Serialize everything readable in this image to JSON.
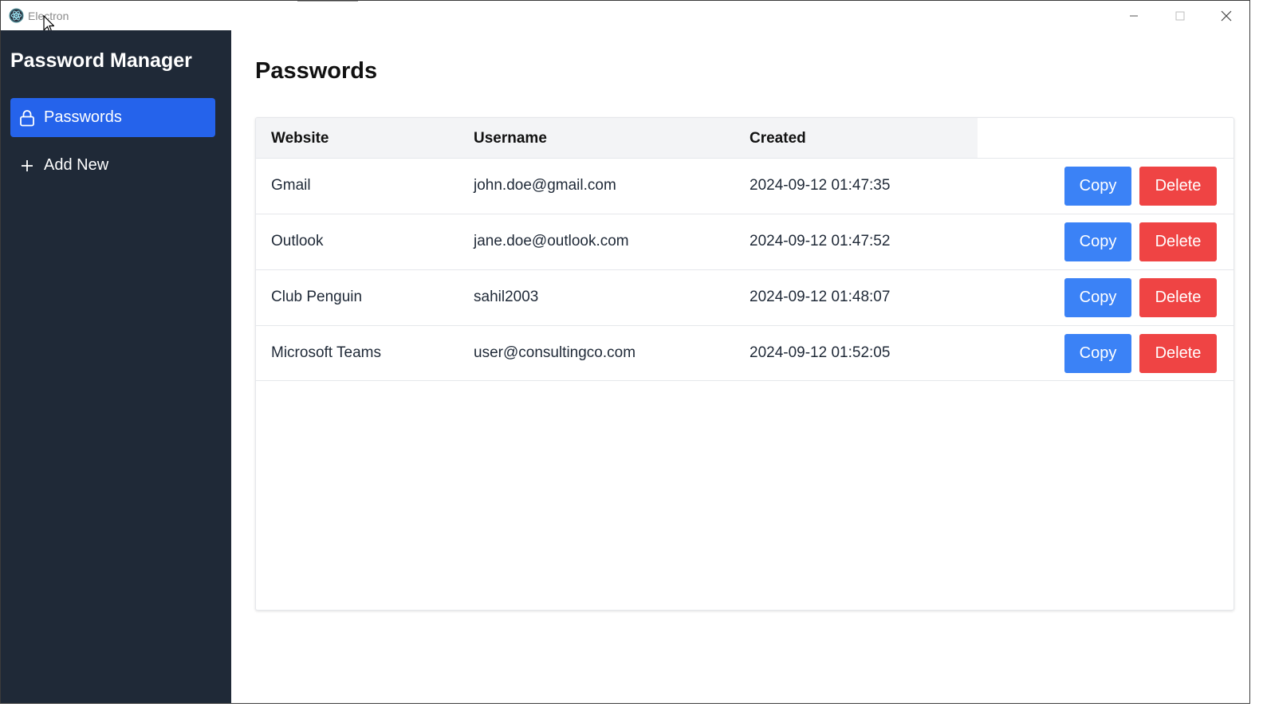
{
  "window": {
    "title": "Electron"
  },
  "sidebar": {
    "brand": "Password Manager",
    "items": [
      {
        "label": "Passwords",
        "icon": "lock-icon",
        "active": true
      },
      {
        "label": "Add New",
        "icon": "plus-icon",
        "active": false
      }
    ]
  },
  "main": {
    "title": "Passwords",
    "table": {
      "headers": [
        "Website",
        "Username",
        "Created"
      ],
      "rows": [
        {
          "website": "Gmail",
          "username": "john.doe@gmail.com",
          "created": "2024-09-12 01:47:35"
        },
        {
          "website": "Outlook",
          "username": "jane.doe@outlook.com",
          "created": "2024-09-12 01:47:52"
        },
        {
          "website": "Club Penguin",
          "username": "sahil2003",
          "created": "2024-09-12 01:48:07"
        },
        {
          "website": "Microsoft Teams",
          "username": "user@consultingco.com",
          "created": "2024-09-12 01:52:05"
        }
      ],
      "copy_label": "Copy",
      "delete_label": "Delete"
    }
  },
  "colors": {
    "sidebar_bg": "#1f2937",
    "accent": "#2563eb",
    "copy": "#3b82f6",
    "delete": "#ef4444"
  }
}
